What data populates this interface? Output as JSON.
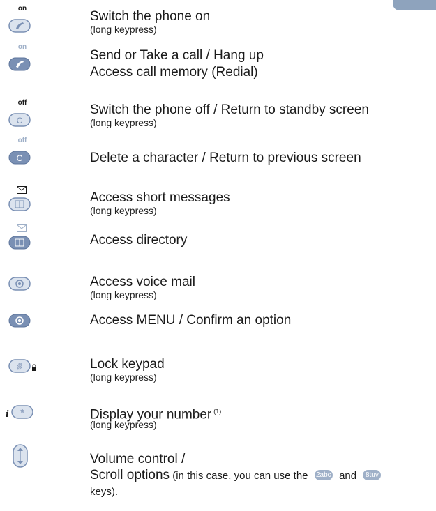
{
  "key_labels": {
    "on": "on",
    "off": "off"
  },
  "icons": {
    "call_outline": "phone-handset-outline-icon",
    "call_filled": "phone-handset-filled-icon",
    "clear_outline": "clear-c-outline-icon",
    "clear_filled": "clear-c-filled-icon",
    "messages_outline": "book-outline-icon",
    "messages_filled": "book-filled-icon",
    "envelope": "envelope-icon",
    "menu_outline": "menu-ring-outline-icon",
    "menu_filled": "menu-ring-filled-icon",
    "hash": "hash-key-icon",
    "lock": "padlock-icon",
    "star": "star-key-icon",
    "info": "info-i-icon",
    "navigation": "up-down-navigation-icon"
  },
  "colors": {
    "key_blue": "#7a90b4",
    "key_light": "#dbe3ee",
    "ink": "#1a1a1a"
  },
  "rows": {
    "switch_on": {
      "main": "Switch the phone on",
      "sub": "(long keypress)"
    },
    "send_call": {
      "main": "Send or Take a call / Hang up",
      "main2": "Access call memory (Redial)"
    },
    "switch_off": {
      "main": "Switch the phone off / Return to standby screen",
      "sub": "(long keypress)"
    },
    "delete_char": {
      "main": "Delete a character / Return to previous screen"
    },
    "short_msgs": {
      "main": "Access short messages",
      "sub": "(long keypress)"
    },
    "directory": {
      "main": "Access directory"
    },
    "voice_mail": {
      "main": "Access voice mail",
      "sub": "(long keypress)"
    },
    "menu": {
      "main": "Access MENU / Confirm an option"
    },
    "lock_keypad": {
      "main": "Lock keypad",
      "sub": "(long keypress)"
    },
    "display_number": {
      "main": "Display your number",
      "footnote": "(1)",
      "sub": "(long keypress)"
    },
    "volume": {
      "main": "Volume control /",
      "scroll_bold": "Scroll options",
      "scroll_rest": " (in this case, you can use the",
      "key1": "2abc",
      "and": "and",
      "key2": "8tuv",
      "keys_end": "keys)."
    }
  }
}
